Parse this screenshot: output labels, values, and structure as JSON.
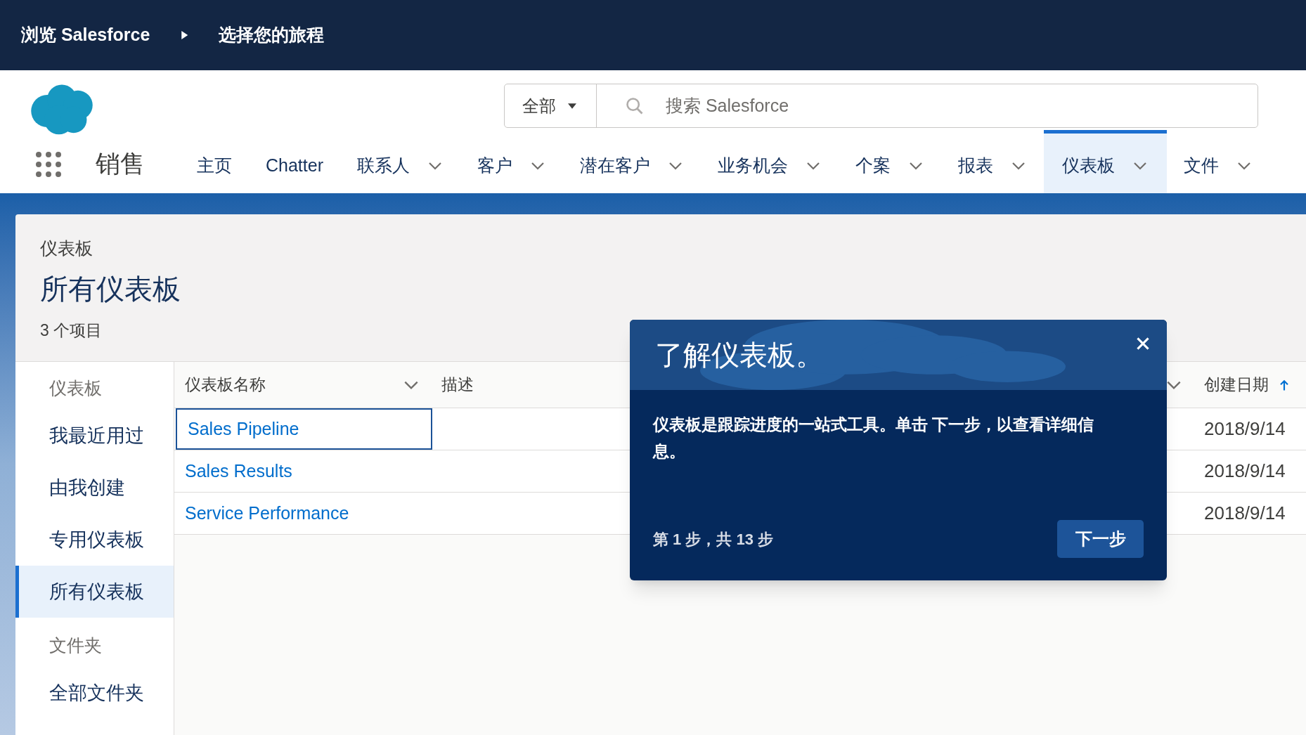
{
  "breadcrumb": [
    "浏览 Salesforce",
    "选择您的旅程"
  ],
  "search": {
    "scope": "全部",
    "placeholder": "搜索 Salesforce"
  },
  "app_name": "销售",
  "nav_tabs": [
    {
      "label": "主页",
      "has_menu": false,
      "selected": false
    },
    {
      "label": "Chatter",
      "has_menu": false,
      "selected": false
    },
    {
      "label": "联系人",
      "has_menu": true,
      "selected": false
    },
    {
      "label": "客户",
      "has_menu": true,
      "selected": false
    },
    {
      "label": "潜在客户",
      "has_menu": true,
      "selected": false
    },
    {
      "label": "业务机会",
      "has_menu": true,
      "selected": false
    },
    {
      "label": "个案",
      "has_menu": true,
      "selected": false
    },
    {
      "label": "报表",
      "has_menu": true,
      "selected": false
    },
    {
      "label": "仪表板",
      "has_menu": true,
      "selected": true
    },
    {
      "label": "文件",
      "has_menu": true,
      "selected": false
    }
  ],
  "page_header": {
    "object": "仪表板",
    "title": "所有仪表板",
    "count": "3 个项目"
  },
  "sidebar": [
    {
      "heading": "仪表板",
      "items": [
        {
          "label": "我最近用过",
          "selected": false
        },
        {
          "label": "由我创建",
          "selected": false
        },
        {
          "label": "专用仪表板",
          "selected": false
        },
        {
          "label": "所有仪表板",
          "selected": true
        }
      ]
    },
    {
      "heading": "文件夹",
      "items": [
        {
          "label": "全部文件夹",
          "selected": false
        }
      ]
    }
  ],
  "table": {
    "columns": [
      {
        "label": "仪表板名称",
        "menu": true,
        "sorted": false
      },
      {
        "label": "描述",
        "menu": true,
        "sorted": false
      },
      {
        "label": "创建日期",
        "menu": false,
        "sorted": true
      }
    ],
    "rows": [
      {
        "name": "Sales Pipeline",
        "focused": true,
        "created": "2018/9/14"
      },
      {
        "name": "Sales Results",
        "focused": false,
        "created": "2018/9/14"
      },
      {
        "name": "Service Performance",
        "focused": false,
        "created": "2018/9/14"
      }
    ]
  },
  "popover": {
    "title": "了解仪表板。",
    "body": "仪表板是跟踪进度的一站式工具。单击 下一步，以查看详细信息。",
    "progress": "第 1 步，共 13 步",
    "next_button": "下一步"
  }
}
